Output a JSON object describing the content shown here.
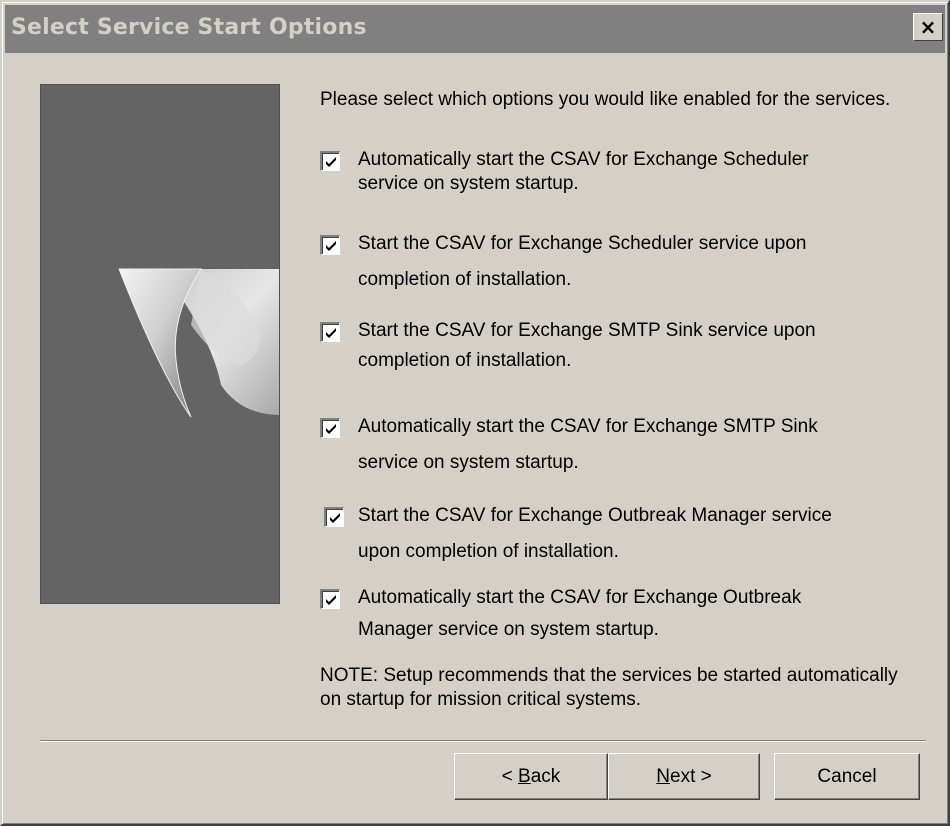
{
  "window": {
    "title": "Select Service Start Options",
    "close_label": "×"
  },
  "main": {
    "intro": "Please select which options you would like enabled for the services.",
    "options": [
      {
        "line1": "Automatically start the CSAV for Exchange Scheduler",
        "line2": "service on system startup.",
        "checked": true
      },
      {
        "line1": "Start the CSAV for Exchange Scheduler service upon",
        "line2": "completion of installation.",
        "checked": true
      },
      {
        "line1": "Start the CSAV for Exchange SMTP Sink service upon",
        "line2": "completion of installation.",
        "checked": true
      },
      {
        "line1": "Automatically start the CSAV for Exchange SMTP Sink",
        "line2": "service on system startup.",
        "checked": true
      },
      {
        "line1": "Start the CSAV for Exchange Outbreak Manager service",
        "line2": "upon completion of installation.",
        "checked": true
      },
      {
        "line1": "Automatically start the CSAV for Exchange Outbreak",
        "line2": "Manager service on system startup.",
        "checked": true
      }
    ],
    "note": "NOTE: Setup recommends that the services be started automatically on startup for mission critical systems."
  },
  "buttons": {
    "back_prefix": "< ",
    "back_hotkey": "B",
    "back_rest": "ack",
    "next_hotkey": "N",
    "next_rest": "ext >",
    "cancel": "Cancel"
  }
}
